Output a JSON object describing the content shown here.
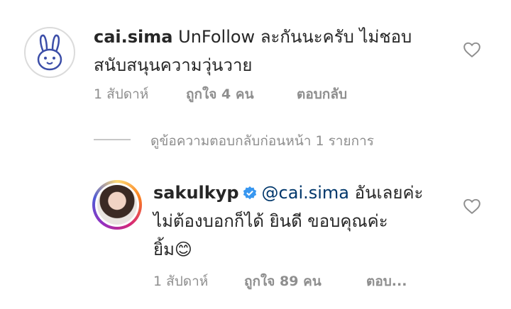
{
  "comment": {
    "username": "cai.sima",
    "text_line1": "UnFollow ละกันนะครับ ไม่ชอบ",
    "text_line2": "สนับสนุนความวุ่นวาย",
    "time": "1 สัปดาห์",
    "likes": "ถูกใจ 4 คน",
    "reply": "ตอบกลับ",
    "avatar_icon": "bunny-icon"
  },
  "view_replies": "ดูข้อความตอบกลับก่อนหน้า 1 รายการ",
  "reply": {
    "username": "sakulkyp",
    "mention": "@cai.sima",
    "text_line1_rest": "อันเลยค่ะ",
    "text_line2": "ไม่ต้องบอกก็ได้ ยินดี ขอบคุณค่ะ",
    "text_line3": "ยิ้ม",
    "emoji": "😊",
    "time": "1 สัปดาห์",
    "likes": "ถูกใจ 89 คน",
    "reply": "ตอบ..."
  },
  "colors": {
    "text": "#262626",
    "muted": "#8e8e8e",
    "mention": "#00376b",
    "verified": "#3897f0"
  }
}
